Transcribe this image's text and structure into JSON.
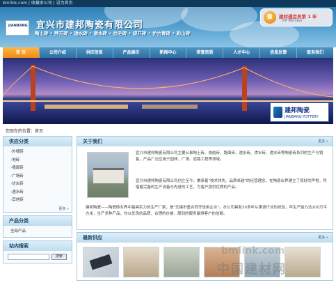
{
  "topbar": {
    "text": "bmlink.com | 收藏本公司 | 设为首页"
  },
  "header": {
    "company_name": "宜兴市建邦陶瓷有限公司",
    "products_line": "陶土砖 • 劈开砖 • 透水砖 • 渗水砖 • 拉毛砖 • 烧开砖 • 仿古青砖 • 彩山砖",
    "badge_title": "建材通会员第 1 年",
    "badge_sub": "VIP Member"
  },
  "nav": [
    "首 页",
    "公司介绍",
    "供应信息",
    "产品展示",
    "新闻中心",
    "荣誉资质",
    "人才中心",
    "信息反馈",
    "联系我们"
  ],
  "banner": {
    "logo_cn": "建邦陶瓷",
    "logo_en": "JIANBANG POTTERY"
  },
  "breadcrumb": "您现在的位置：首页",
  "sidebar": {
    "supply_title": "供应分类",
    "supply_items": [
      "外墙砖",
      "地砖",
      "墙面砖",
      "广场砖",
      "仿古砖",
      "透水砖",
      "其他砖"
    ],
    "more": "更多 »",
    "products_title": "产品分类",
    "products_all": "全部产品",
    "search_title": "站内搜索",
    "search_button": "搜索"
  },
  "about": {
    "title": "关于我们",
    "more": "更多 »",
    "p1": "宜兴市建邦陶瓷有限公司主要从事陶土砖、烧结砖、路面砖、透水砖、渗水砖、透水砖等陶瓷砖系列的生产与销售，产品广泛应用于园林、广场、道路工程等领域。",
    "p2": "宜兴市建邦陶瓷有限公司创立至今，秉承着\"技术领先、品质卓越\"的经营理念，在陶瓷业界建立了良好的声誉，凭借着完备的生产设备与先进的工艺，为客户提供优质的产品。",
    "p3": "建邦陶瓷——陶瓷砖业界中最具实力的生产厂家，是\"无锡市重合同守信用企业\"。本公司具有30多年从事该行业的经验，年生产能力达200万平方米，生产多种产品，均以优良的品质、合理的价格、周到的服务赢得客户的信赖。"
  },
  "new_products": {
    "title": "最新供应",
    "more": "更多 »"
  },
  "watermark": {
    "cn": "中国建材网",
    "en": "bmlink.com"
  }
}
